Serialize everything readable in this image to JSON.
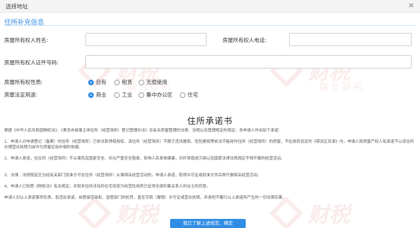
{
  "dialog": {
    "title": "选择地址",
    "close_icon": "×"
  },
  "section": {
    "title": "住所补充信息"
  },
  "form": {
    "owner_name_label": "房屋所有权人姓名:",
    "owner_name_value": "",
    "owner_phone_label": "房屋所有权人电话:",
    "owner_phone_value": "",
    "owner_id_label": "房屋所有权人证件号码:",
    "owner_id_value": "",
    "ownership_label": "房屋所有权性质:",
    "ownership_options": [
      {
        "label": "自有",
        "checked": true
      },
      {
        "label": "租赁",
        "checked": false
      },
      {
        "label": "无偿使用",
        "checked": false
      }
    ],
    "usage_label": "房屋法定用途:",
    "usage_options": [
      {
        "label": "商业",
        "checked": true
      },
      {
        "label": "工业",
        "checked": false
      },
      {
        "label": "集中办公区",
        "checked": false
      },
      {
        "label": "住宅",
        "checked": false
      }
    ]
  },
  "promise": {
    "title": "住所承诺书",
    "paragraphs": [
      "根据《中华人民共和国物权法》、《青岛市商事主体住所（经营场所）登记管理办法》及有关房屋管理的法律、法规以及管理规定的规定，本申请人作出如下承诺：",
      "1、申请人对申请登记（备案）的住所（经营场所）已依法取得使用权，该住所（经营场所）不属于违法建筑、危险建筑等依法不能用作住所（经营场所）的房屋，不在政府设定的《禁设区目录》内，申请人和房屋产权人有承诺不以该住所办理营业执照为由作为房屋征收补偿的依据。",
      "2、申请人承诺，在住所（经营场所）不从事危及国家安全、存在严重安全隐患，影响人民身体健康，对环境造成污染以及国家法律法规规定不得开展的经营活动。",
      "3、法律、法规规定应当经有关部门批准方可在住所（经营场所）从事相关经营活动的，申请人承诺，取得许可证或批准文件后再开展相关经营活动。",
      "4、申请人已知悉《物权法》有关规定，并就本住所涉及的住宅改变为经营性用房已征得全部利害关系人的业主的同意。",
      "申请人对以上承诺事项负责，若违反承诺，自愿接受审批、监管部门的处罚，直至吊销（撤销）许可证或营业执照，并承担不履行以上承诺所产生的一切法律后果。"
    ]
  },
  "confirm_button": "我已了解上述规定，确定",
  "watermark": {
    "big": "财税",
    "small": "联合联拓",
    "color": "#c0392b"
  },
  "colors": {
    "accent": "#2f8de4"
  }
}
